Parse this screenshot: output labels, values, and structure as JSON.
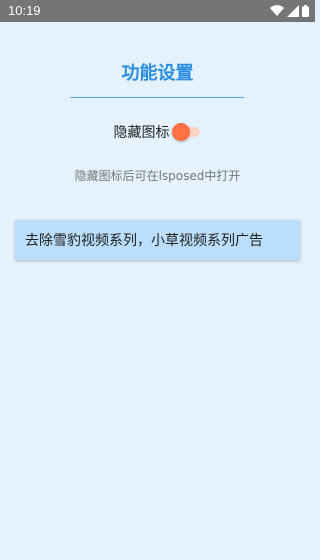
{
  "status_bar": {
    "time": "10:19",
    "icons": [
      "wifi-icon",
      "signal-icon",
      "battery-icon"
    ]
  },
  "page": {
    "title": "功能设置",
    "hide_icon": {
      "label": "隐藏图标",
      "enabled": true
    },
    "hint": "隐藏图标后可在lsposed中打开",
    "items": [
      {
        "label": "去除雪豹视频系列，小草视频系列广告"
      }
    ]
  },
  "colors": {
    "background": "#e3f2fd",
    "title": "#2a8ee0",
    "switch_on": "#ff7043",
    "card": "#bbdefb",
    "status_bar": "#757575"
  }
}
